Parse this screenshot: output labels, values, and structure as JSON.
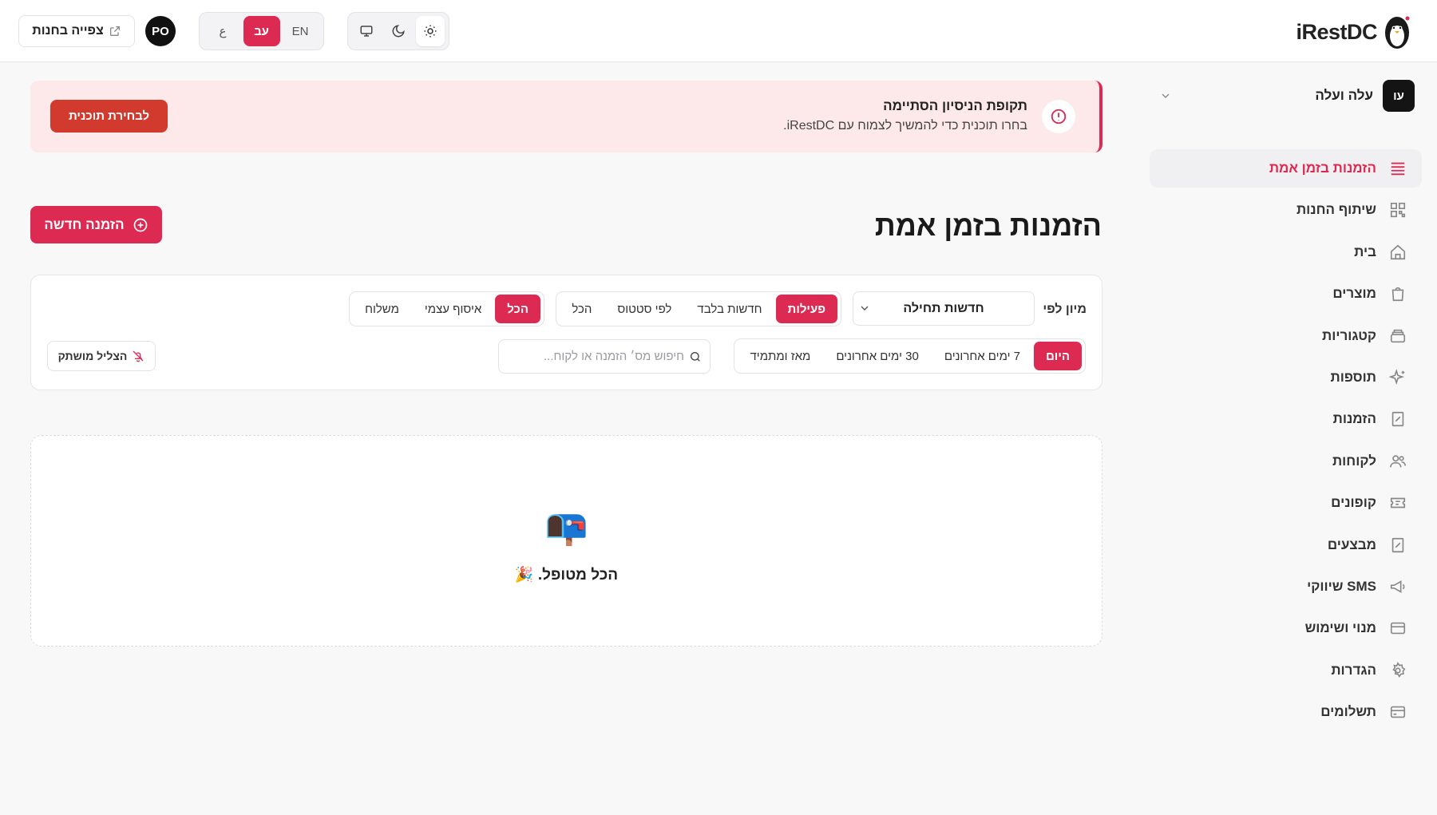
{
  "brand": {
    "name": "iRestDC"
  },
  "topbar": {
    "view_store_label": "צפייה בחנות",
    "avatar_initials": "PO",
    "languages": [
      "EN",
      "עב",
      "ع"
    ],
    "active_language": "עב",
    "theme_options": [
      "system",
      "dark",
      "light"
    ],
    "active_theme": "light"
  },
  "sidebar": {
    "org": {
      "badge": "עו",
      "name": "עלה ועלה"
    },
    "items": [
      {
        "label": "הזמנות בזמן אמת",
        "icon": "list-icon",
        "active": true
      },
      {
        "label": "שיתוף החנות",
        "icon": "qr-code-icon",
        "active": false
      },
      {
        "label": "בית",
        "icon": "home-icon",
        "active": false
      },
      {
        "label": "מוצרים",
        "icon": "shopping-bag-icon",
        "active": false
      },
      {
        "label": "קטגוריות",
        "icon": "layers-icon",
        "active": false
      },
      {
        "label": "תוספות",
        "icon": "sparkles-icon",
        "active": false
      },
      {
        "label": "הזמנות",
        "icon": "receipt-icon",
        "active": false
      },
      {
        "label": "לקוחות",
        "icon": "users-icon",
        "active": false
      },
      {
        "label": "קופונים",
        "icon": "ticket-icon",
        "active": false
      },
      {
        "label": "מבצעים",
        "icon": "percent-receipt-icon",
        "active": false
      },
      {
        "label": "SMS שיווקי",
        "icon": "megaphone-icon",
        "active": false
      },
      {
        "label": "מנוי ושימוש",
        "icon": "card-icon",
        "active": false
      },
      {
        "label": "הגדרות",
        "icon": "gear-icon",
        "active": false
      },
      {
        "label": "תשלומים",
        "icon": "credit-card-icon",
        "active": false
      }
    ]
  },
  "banner": {
    "title": "תקופת הניסיון הסתיימה",
    "text": "בחרו תוכנית כדי להמשיך לצמוח עם iRestDC.",
    "button_label": "לבחירת תוכנית"
  },
  "page": {
    "title": "הזמנות בזמן אמת",
    "new_order_label": "הזמנה חדשה"
  },
  "filters": {
    "sort_label": "מיון לפי",
    "sort_value": "חדשות תחילה",
    "status_options": [
      "פעילות",
      "חדשות בלבד",
      "לפי סטטוס",
      "הכל"
    ],
    "status_active": "פעילות",
    "fulfillment_options": [
      "הכל",
      "איסוף עצמי",
      "משלוח"
    ],
    "fulfillment_active": "הכל",
    "date_options": [
      "היום",
      "7 ימים אחרונים",
      "30 ימים אחרונים",
      "מאז ומתמיד"
    ],
    "date_active": "היום",
    "search_placeholder": "חיפוש מס׳ הזמנה או לקוח...",
    "mute_label": "הצליל מושתק"
  },
  "empty_state": {
    "emoji": "📭",
    "text": "הכל מטופל. 🎉"
  },
  "colors": {
    "accent": "#dc2a52",
    "banner_bg": "#fde9e9",
    "plan_button": "#d33a2e"
  }
}
